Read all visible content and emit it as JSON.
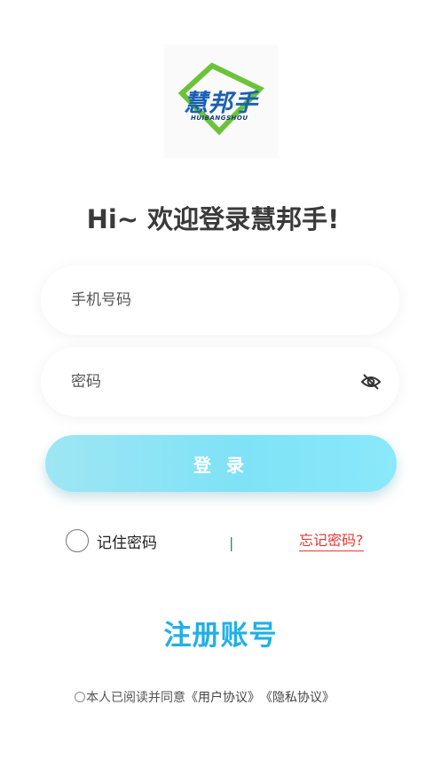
{
  "logo": {
    "main_text": "慧邦手",
    "sub_text": "HUIBANGSHOU",
    "frame_color": "#6cc33a",
    "text_color": "#1a5fb4"
  },
  "greeting": "Hi~ 欢迎登录慧邦手!",
  "form": {
    "phone_placeholder": "手机号码",
    "password_placeholder": "密码",
    "password_toggle_icon": "eye-slash-icon",
    "login_label": "登 录",
    "remember_label": "记住密码",
    "divider": "|",
    "forgot_label": "忘记密码?"
  },
  "register_label": "注册账号",
  "agreement": {
    "prefix": "本人已阅读并同意",
    "user_agreement": "《用户协议》",
    "privacy_agreement": "《隐私协议》"
  },
  "colors": {
    "accent": "#21b0e6",
    "button_gradient_start": "#9ee6f4",
    "button_gradient_end": "#8ae9fb",
    "forgot_link": "#e53935"
  }
}
